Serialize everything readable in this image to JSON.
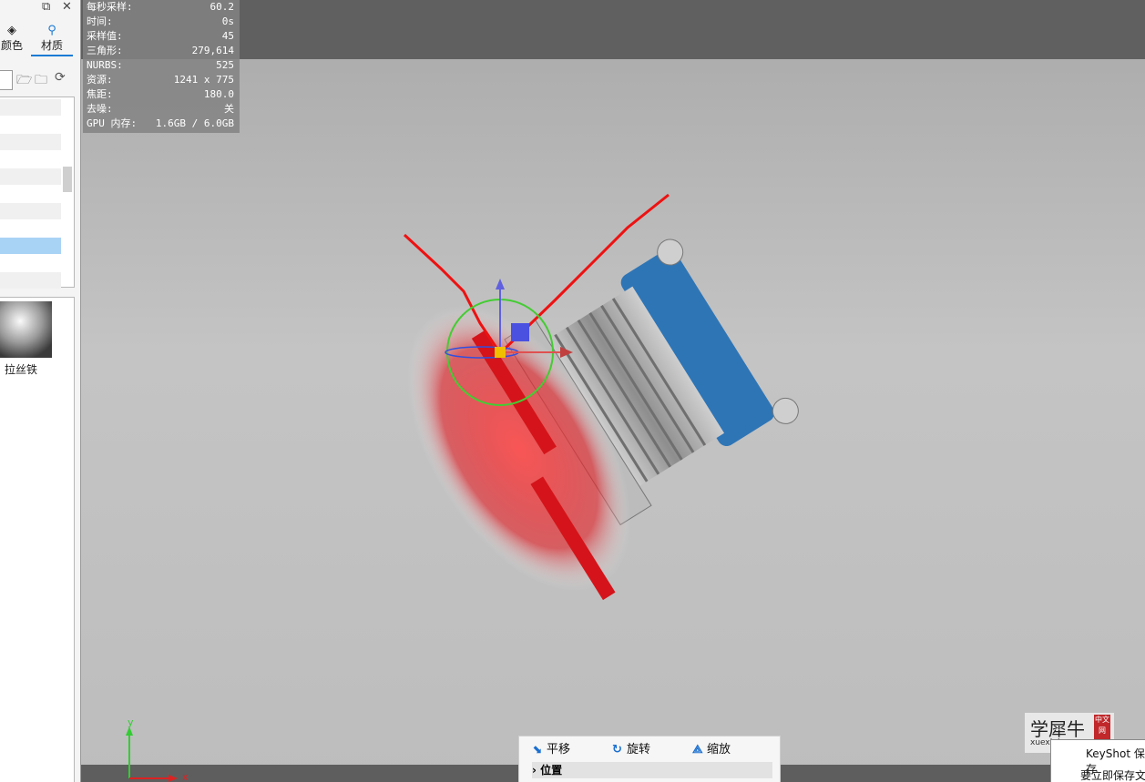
{
  "left_panel": {
    "tabs": [
      {
        "label": "颜色",
        "icon": "paint-bucket-icon"
      },
      {
        "label": "材质",
        "icon": "material-person-icon"
      }
    ],
    "window_icons": [
      "restore-icon",
      "close-icon"
    ],
    "material_item": {
      "name": "拉丝铁"
    }
  },
  "stats": [
    {
      "label": "每秒采样:",
      "value": "60.2"
    },
    {
      "label": "时间:",
      "value": "0s"
    },
    {
      "label": "采样值:",
      "value": "45"
    },
    {
      "label": "三角形:",
      "value": "279,614"
    },
    {
      "label": "NURBS:",
      "value": "525"
    },
    {
      "label": "资源:",
      "value": "1241 x 775"
    },
    {
      "label": "焦距:",
      "value": "180.0"
    },
    {
      "label": "去噪:",
      "value": "关"
    },
    {
      "label": "GPU 内存:",
      "value": "1.6GB / 6.0GB"
    }
  ],
  "axis_labels": {
    "y": "y",
    "x": "x"
  },
  "move_tool": {
    "translate": "平移",
    "rotate": "旋转",
    "scale": "缩放",
    "position": "位置"
  },
  "watermark": {
    "title": "学犀牛",
    "url": "xuexiniu.com",
    "badge": "中文网"
  },
  "dialog": {
    "title": "KeyShot 保存",
    "text": "要立即保存文"
  },
  "colors": {
    "button_red": "#d4141a",
    "insulator_blue": "#2e75b6",
    "metal": "#a8a8a8",
    "accent": "#1a7ad4"
  }
}
